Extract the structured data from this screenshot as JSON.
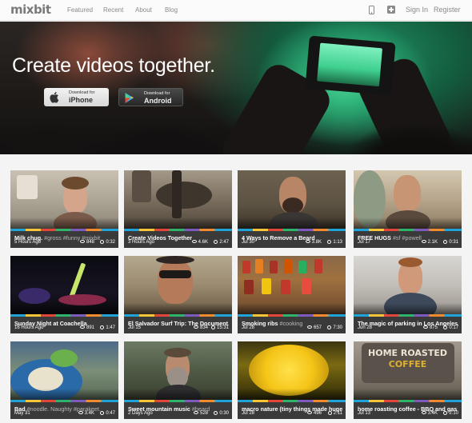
{
  "nav": {
    "logo": "mixbit",
    "links": [
      "Featured",
      "Recent",
      "About",
      "Blog"
    ],
    "sign_in": "Sign In",
    "register": "Register",
    "phone_icon": "phone-icon",
    "upload_icon": "plus-icon"
  },
  "hero": {
    "title": "Create videos together.",
    "iphone_small": "Download for",
    "iphone_big": "iPhone",
    "android_small": "Download for",
    "android_big": "Android"
  },
  "videos": [
    {
      "time": "5 Hours Ago",
      "views": "848",
      "duration": "0:32",
      "title": "Milk chug.",
      "tags": "#gross #funny #mixbit"
    },
    {
      "time": "3 Hours Ago",
      "views": "4.6K",
      "duration": "2:47",
      "title": "Create Videos Together",
      "tags": ""
    },
    {
      "time": "Jul 30",
      "views": "3.8K",
      "duration": "1:13",
      "title": "4 Ways to Remove a Beard",
      "tags": ""
    },
    {
      "time": "Jul 17",
      "views": "2.1K",
      "duration": "0:31",
      "title": "FREE HUGS",
      "tags": "#sf #powell"
    },
    {
      "time": "16 Hours Ago",
      "views": "891",
      "duration": "1:47",
      "title": "Sunday Night at Coachella",
      "tags": ""
    },
    {
      "time": "Jul 15",
      "views": "834",
      "duration": "15:31",
      "title": "El Salvador Surf Trip: The Document...",
      "tags": ""
    },
    {
      "time": "Jul 28",
      "views": "657",
      "duration": "7:30",
      "title": "Smoking ribs",
      "tags": "#cooking"
    },
    {
      "time": "Jun 28",
      "views": "875",
      "duration": "0:17",
      "title": "The magic of parking in Los Angeles.",
      "tags": ""
    },
    {
      "time": "May 31",
      "views": "3.4K",
      "duration": "0:47",
      "title": "Bad",
      "tags": "#noodle. Naughty #parakeet."
    },
    {
      "time": "2 Days Ago",
      "views": "528",
      "duration": "0:30",
      "title": "Sweet mountain music",
      "tags": "#beard"
    },
    {
      "time": "Jul 28",
      "views": "496",
      "duration": "2:11",
      "title": "macro nature (tiny things made huge)",
      "tags": ""
    },
    {
      "time": "Jul 13",
      "views": "3.4K",
      "duration": "2:10",
      "title": "home roasting coffee - BBQ and gas",
      "tags": ""
    }
  ],
  "thumb_text": {
    "coffee_line1": "HOME ROASTED",
    "coffee_line2": "COFFEE"
  },
  "colors": {
    "accent_green": "#2fb37a",
    "stripe": [
      "#1fa3d8",
      "#f7c53a",
      "#e2463b",
      "#2fb26a",
      "#7d5bbd",
      "#f18b2f"
    ]
  }
}
